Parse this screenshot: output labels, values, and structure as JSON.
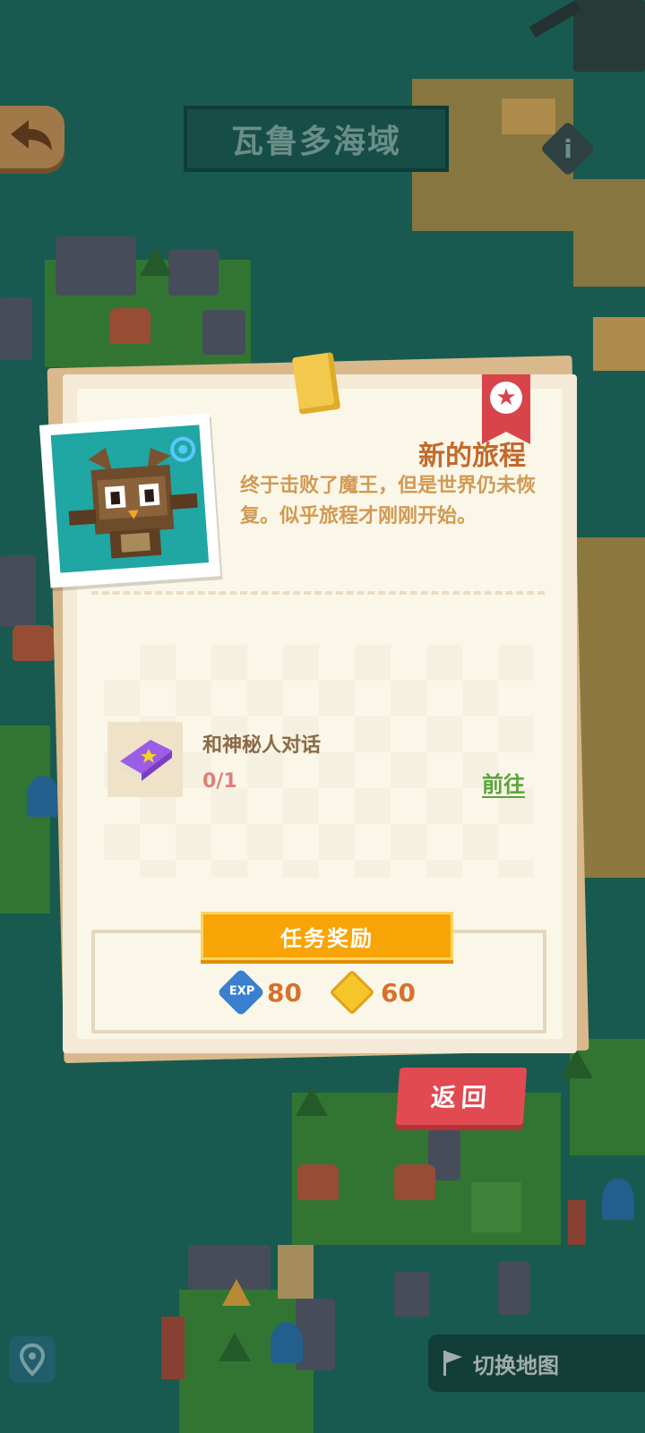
{
  "header": {
    "region_title": "瓦鲁多海域",
    "back_icon": "back-arrow-icon",
    "info_icon": "info-icon",
    "info_glyph": "i"
  },
  "quest": {
    "title": "新的旅程",
    "description": "终于击败了魔王，但是世界仍未恢复。似乎旅程才刚刚开始。",
    "task": {
      "icon": "purple-book-icon",
      "name": "和神秘人对话",
      "progress": "0/1",
      "goto_label": "前往"
    },
    "reward": {
      "label": "任务奖励",
      "exp_icon_label": "EXP",
      "exp": "80",
      "coin": "60"
    },
    "return_label": "返回"
  },
  "footer": {
    "switch_map_label": "切换地图"
  },
  "colors": {
    "accent_orange": "#f9a406",
    "title_orange": "#c36a2c",
    "return_red": "#e04a50",
    "link_green": "#5aa33a",
    "sea": "#1f6b5e"
  }
}
